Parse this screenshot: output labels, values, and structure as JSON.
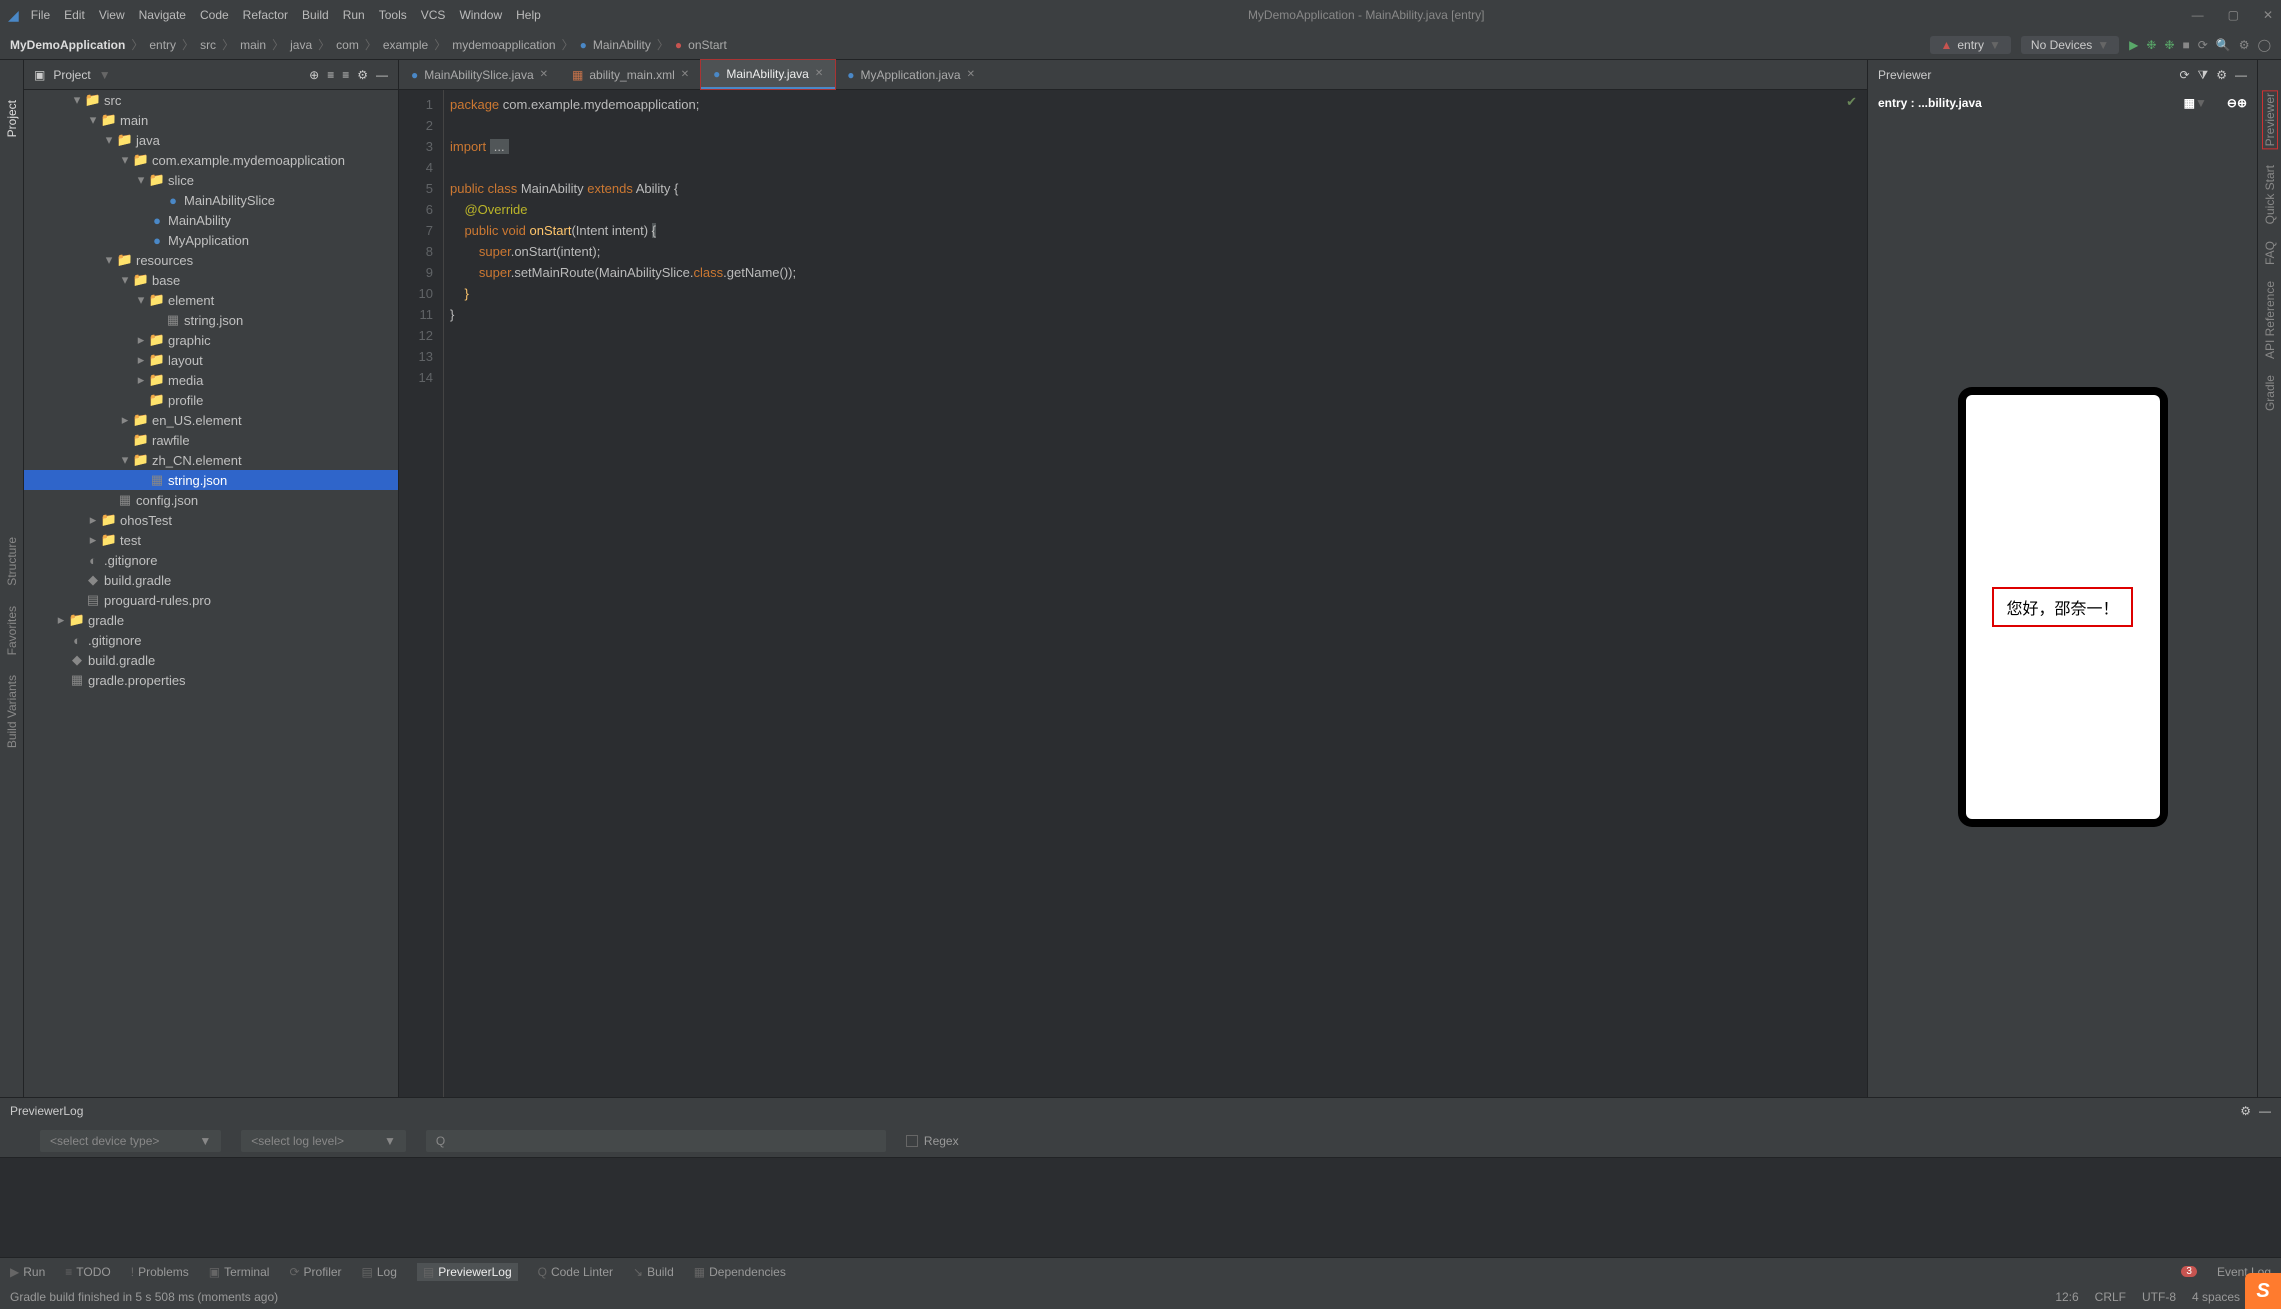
{
  "app_title": "MyDemoApplication - MainAbility.java [entry]",
  "menu": [
    "File",
    "Edit",
    "View",
    "Navigate",
    "Code",
    "Refactor",
    "Build",
    "Run",
    "Tools",
    "VCS",
    "Window",
    "Help"
  ],
  "breadcrumb": [
    "MyDemoApplication",
    "entry",
    "src",
    "main",
    "java",
    "com",
    "example",
    "mydemoapplication",
    "MainAbility",
    "onStart"
  ],
  "run_config": "entry",
  "devices": "No Devices",
  "project_label": "Project",
  "tree": [
    {
      "d": 3,
      "t": "▾",
      "i": "📁",
      "n": "src"
    },
    {
      "d": 4,
      "t": "▾",
      "i": "📁",
      "n": "main"
    },
    {
      "d": 5,
      "t": "▾",
      "i": "📁",
      "n": "java"
    },
    {
      "d": 6,
      "t": "▾",
      "i": "📁",
      "n": "com.example.mydemoapplication"
    },
    {
      "d": 7,
      "t": "▾",
      "i": "📁",
      "n": "slice"
    },
    {
      "d": 8,
      "t": "",
      "i": "●",
      "n": "MainAbilitySlice",
      "c": "#4a88c7"
    },
    {
      "d": 7,
      "t": "",
      "i": "●",
      "n": "MainAbility",
      "c": "#4a88c7"
    },
    {
      "d": 7,
      "t": "",
      "i": "●",
      "n": "MyApplication",
      "c": "#4a88c7"
    },
    {
      "d": 5,
      "t": "▾",
      "i": "📁",
      "n": "resources"
    },
    {
      "d": 6,
      "t": "▾",
      "i": "📁",
      "n": "base"
    },
    {
      "d": 7,
      "t": "▾",
      "i": "📁",
      "n": "element"
    },
    {
      "d": 8,
      "t": "",
      "i": "▦",
      "n": "string.json"
    },
    {
      "d": 7,
      "t": "▸",
      "i": "📁",
      "n": "graphic"
    },
    {
      "d": 7,
      "t": "▸",
      "i": "📁",
      "n": "layout"
    },
    {
      "d": 7,
      "t": "▸",
      "i": "📁",
      "n": "media"
    },
    {
      "d": 7,
      "t": "",
      "i": "📁",
      "n": "profile"
    },
    {
      "d": 6,
      "t": "▸",
      "i": "📁",
      "n": "en_US.element"
    },
    {
      "d": 6,
      "t": "",
      "i": "📁",
      "n": "rawfile"
    },
    {
      "d": 6,
      "t": "▾",
      "i": "📁",
      "n": "zh_CN.element"
    },
    {
      "d": 7,
      "t": "",
      "i": "▦",
      "n": "string.json",
      "sel": true
    },
    {
      "d": 5,
      "t": "",
      "i": "▦",
      "n": "config.json"
    },
    {
      "d": 4,
      "t": "▸",
      "i": "📁",
      "n": "ohosTest"
    },
    {
      "d": 4,
      "t": "▸",
      "i": "📁",
      "n": "test"
    },
    {
      "d": 3,
      "t": "",
      "i": "◐",
      "n": ".gitignore"
    },
    {
      "d": 3,
      "t": "",
      "i": "◆",
      "n": "build.gradle"
    },
    {
      "d": 3,
      "t": "",
      "i": "▤",
      "n": "proguard-rules.pro"
    },
    {
      "d": 2,
      "t": "▸",
      "i": "📁",
      "n": "gradle"
    },
    {
      "d": 2,
      "t": "",
      "i": "◐",
      "n": ".gitignore"
    },
    {
      "d": 2,
      "t": "",
      "i": "◆",
      "n": "build.gradle"
    },
    {
      "d": 2,
      "t": "",
      "i": "▦",
      "n": "gradle.properties"
    }
  ],
  "editor_tabs": [
    {
      "icon": "●",
      "label": "MainAbilitySlice.java",
      "c": "#4a88c7"
    },
    {
      "icon": "▦",
      "label": "ability_main.xml",
      "c": "#c7734a"
    },
    {
      "icon": "●",
      "label": "MainAbility.java",
      "c": "#4a88c7",
      "active": true,
      "hl": true
    },
    {
      "icon": "●",
      "label": "MyApplication.java",
      "c": "#4a88c7"
    }
  ],
  "code": {
    "l1": "package com.example.mydemoapplication;",
    "l3a": "import ",
    "l3b": "...",
    "l5": "public class MainAbility extends Ability {",
    "l6": "    @Override",
    "l7": "    public void onStart(Intent intent) {",
    "l8": "        super.onStart(intent);",
    "l9": "        super.setMainRoute(MainAbilitySlice.class.getName());",
    "l10": "    }",
    "l11": "}"
  },
  "lines": [
    "1",
    "2",
    "3",
    "4",
    "5",
    "6",
    "7",
    "8",
    "9",
    "10",
    "11",
    "12",
    "13",
    "14"
  ],
  "previewer": {
    "title": "Previewer",
    "sub": "entry : ...bility.java",
    "hello": "您好，邵奈一！"
  },
  "bp": {
    "title": "PreviewerLog",
    "device_ph": "<select device type>",
    "log_ph": "<select log level>",
    "regex": "Regex"
  },
  "bottom_items": [
    "Run",
    "TODO",
    "Problems",
    "Terminal",
    "Profiler",
    "Log",
    "PreviewerLog",
    "Code Linter",
    "Build",
    "Dependencies"
  ],
  "bottom_icons": [
    "▶",
    "≡",
    "!",
    "▣",
    "⟳",
    "▤",
    "▤",
    "Q",
    "↘",
    "▦"
  ],
  "event_log": {
    "count": "3",
    "label": "Event Log"
  },
  "status": {
    "msg": "Gradle build finished in 5 s 508 ms (moments ago)",
    "pos": "12:6",
    "eol": "CRLF",
    "enc": "UTF-8",
    "indent": "4 spaces"
  },
  "left_tools": [
    "Project",
    "Structure",
    "Favorites",
    "Build Variants"
  ],
  "right_tools": [
    "Previewer",
    "Quick Start",
    "FAQ",
    "API Reference",
    "Gradle"
  ]
}
